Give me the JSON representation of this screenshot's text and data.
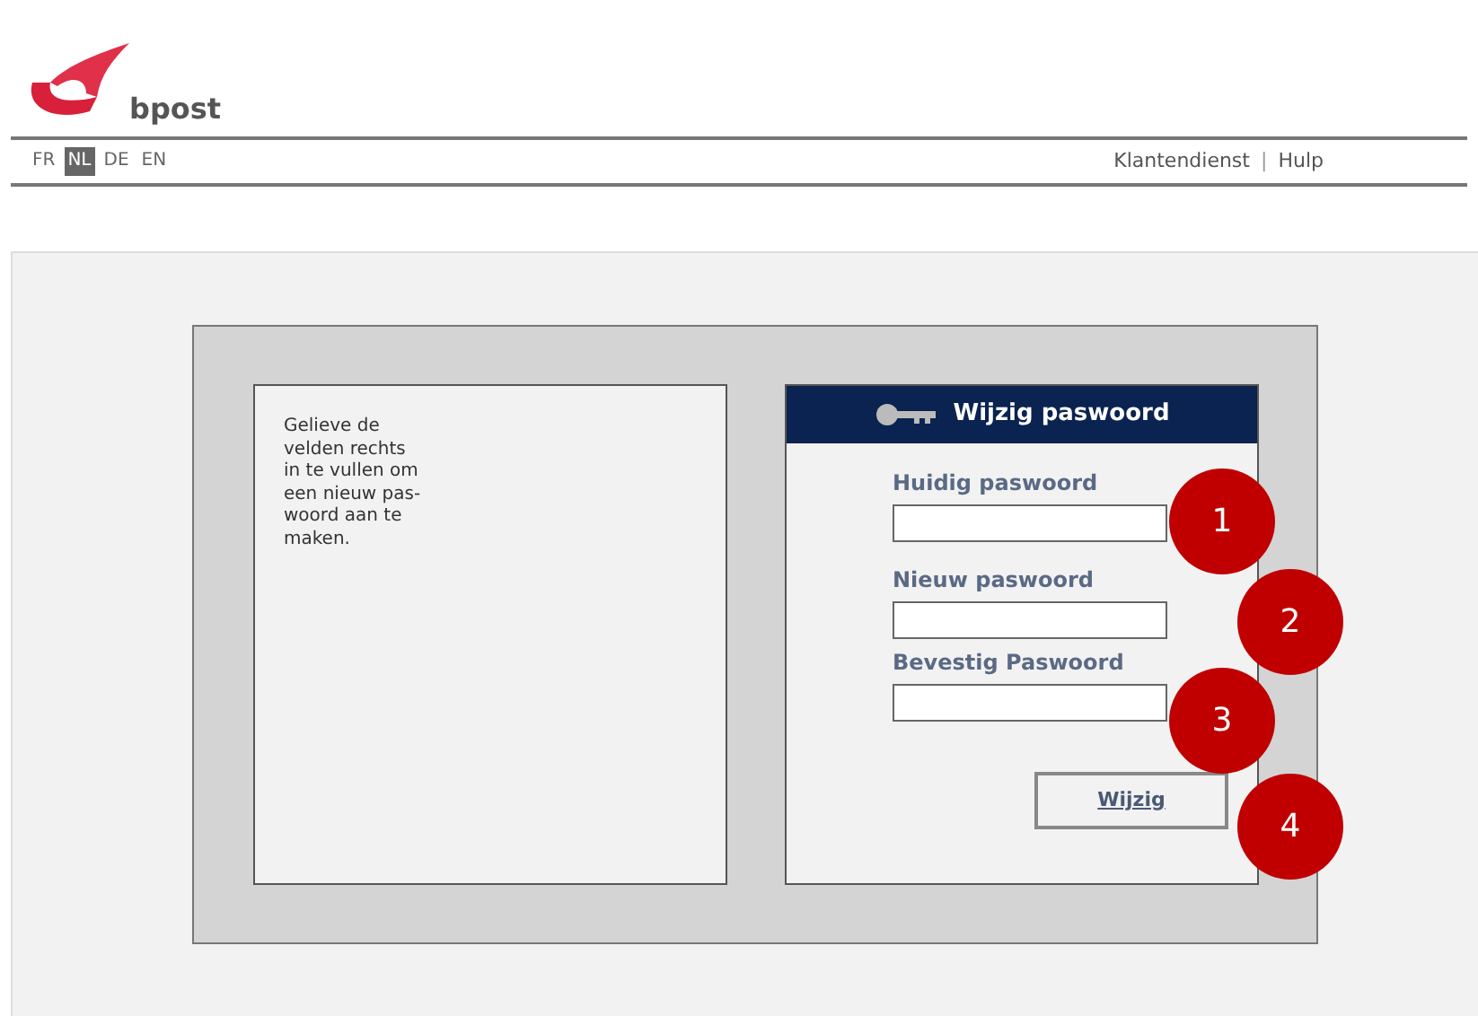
{
  "brand": {
    "name": "bpost"
  },
  "languages": [
    {
      "label": "FR",
      "selected": false
    },
    {
      "label": "NL",
      "selected": true
    },
    {
      "label": "DE",
      "selected": false
    },
    {
      "label": "EN",
      "selected": false
    }
  ],
  "top_links": [
    "Klantendienst",
    "|",
    "Hulp"
  ],
  "instructions": {
    "lines": [
      "Gelieve de",
      "velden rechts",
      "in te vullen om",
      "een nieuw pas-",
      "woord aan te",
      "maken."
    ]
  },
  "form": {
    "title": "Wijzig paswoord",
    "fields": [
      {
        "label": "Huidig paswoord"
      },
      {
        "label": "Nieuw paswoord"
      },
      {
        "label": "Bevestig Paswoord"
      }
    ],
    "submit": "Wijzig"
  },
  "callouts": [
    "1",
    "2",
    "3",
    "4"
  ]
}
